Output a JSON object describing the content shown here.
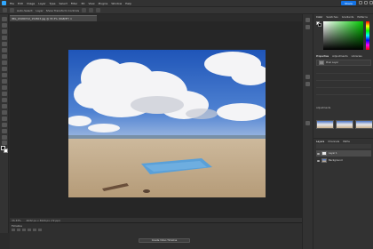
{
  "menubar": {
    "items": [
      "File",
      "Edit",
      "Image",
      "Layer",
      "Type",
      "Select",
      "Filter",
      "3D",
      "View",
      "Plugins",
      "Window",
      "Help"
    ],
    "share_label": "Share"
  },
  "options": {
    "items": [
      "Auto-Select:",
      "Layer",
      "Show Transform Controls"
    ]
  },
  "document": {
    "tab_title": "IMG_20180712_154503.jpg @ 33.3% (RGB/8*) ×",
    "status": "33.33%",
    "doc_info": "4032 px x 3024 px (72 ppi)"
  },
  "timeline": {
    "title": "Timeline",
    "create_button": "Create Video Timeline"
  },
  "color_panel": {
    "tabs": [
      "Color",
      "Swatches",
      "Gradients",
      "Patterns"
    ]
  },
  "properties_panel": {
    "tabs": [
      "Properties",
      "Adjustments",
      "Libraries"
    ],
    "layer_kind": "Pixel Layer",
    "adjustments_label": "Adjustments"
  },
  "layers_panel": {
    "tabs": [
      "Layers",
      "Channels",
      "Paths"
    ],
    "layers": [
      {
        "name": "Layer 1",
        "selected": true
      },
      {
        "name": "Background",
        "selected": false
      }
    ]
  },
  "colors": {
    "accent": "#1473e6",
    "ps_blue": "#31a8ff",
    "workspace": "#262626",
    "panel": "#323232"
  }
}
